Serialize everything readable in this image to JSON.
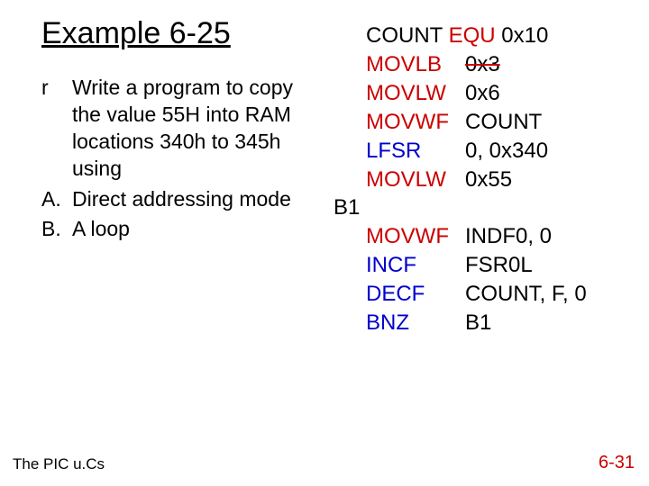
{
  "title": "Example 6-25",
  "bullets": {
    "r_marker": "r",
    "r_text": "Write a program to copy the value 55H into RAM locations 340h to 345h using",
    "a_marker": "A.",
    "a_text": "Direct addressing mode",
    "b_marker": "B.",
    "b_text": "A loop"
  },
  "code": {
    "l1_m": "COUNT",
    "l1_op": "EQU",
    "l1_a": " 0x10",
    "l2_m": "MOVLB",
    "l2_a": "0x3",
    "l3_m": "MOVLW",
    "l3_a": "0x6",
    "l4_m": "MOVWF",
    "l4_a": "COUNT",
    "l5_m": "LFSR",
    "l5_a": "0, 0x340",
    "l6_m": "MOVLW",
    "l6_a": "0x55",
    "label": "B1",
    "l7_m": "MOVWF",
    "l7_a": "INDF0, 0",
    "l8_m": "INCF",
    "l8_a": "FSR0L",
    "l9_m": "DECF",
    "l9_a": "COUNT, F, 0",
    "l10_m": "BNZ",
    "l10_a": "B1"
  },
  "footer": {
    "left": "The PIC u.Cs",
    "right": "6-31"
  }
}
